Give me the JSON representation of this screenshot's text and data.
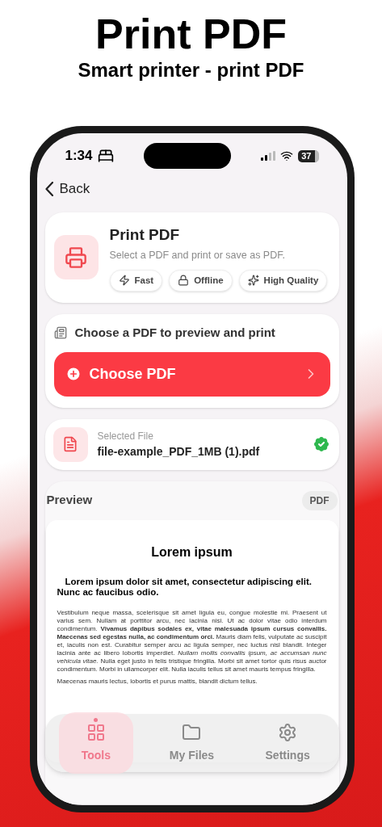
{
  "promo": {
    "title": "Print PDF",
    "subtitle": "Smart printer - print PDF"
  },
  "status_bar": {
    "time": "1:34",
    "battery": "37"
  },
  "nav": {
    "back": "Back"
  },
  "header_card": {
    "title": "Print PDF",
    "description": "Select a PDF and print or save as PDF.",
    "tags": [
      {
        "kind": "bolt",
        "label": "Fast"
      },
      {
        "kind": "lock",
        "label": "Offline"
      },
      {
        "kind": "sparkle",
        "label": "High Quality"
      }
    ]
  },
  "choose_card": {
    "heading": "Choose a PDF to preview and print",
    "button": "Choose PDF"
  },
  "file_card": {
    "label": "Selected File",
    "name": "file-example_PDF_1MB (1).pdf",
    "verified": true
  },
  "preview": {
    "title": "Preview",
    "badge": "PDF",
    "document": {
      "heading": "Lorem ipsum",
      "subheading": "Lorem ipsum dolor sit amet, consectetur adipiscing elit. Nunc ac faucibus odio.",
      "paragraphs": [
        "Vestibulum neque massa, scelerisque sit amet ligula eu, congue molestie mi. Praesent ut varius sem. Nullam at porttitor arcu, nec lacinia nisi. Ut ac dolor vitae odio interdum condimentum. **Vivamus dapibus sodales ex, vitae malesuada ipsum cursus convallis. Maecenas sed egestas nulla, ac condimentum orci.** Mauris diam felis, vulputate ac suscipit et, iaculis non est. Curabitur semper arcu ac ligula semper, nec luctus nisl blandit. Integer lacinia ante ac libero lobortis imperdiet. *Nullam mollis convallis ipsum, ac accumsan nunc vehicula vitae.* Nulla eget justo in felis tristique fringilla. Morbi sit amet tortor quis risus auctor condimentum. Morbi in ullamcorper elit. Nulla iaculis tellus sit amet mauris tempus fringilla.",
        "Maecenas mauris lectus, lobortis et purus mattis, blandit dictum tellus."
      ]
    }
  },
  "tab_bar": [
    {
      "kind": "grid",
      "label": "Tools",
      "selected": true
    },
    {
      "kind": "folder",
      "label": "My Files",
      "selected": false
    },
    {
      "kind": "gear",
      "label": "Settings",
      "selected": false
    }
  ]
}
